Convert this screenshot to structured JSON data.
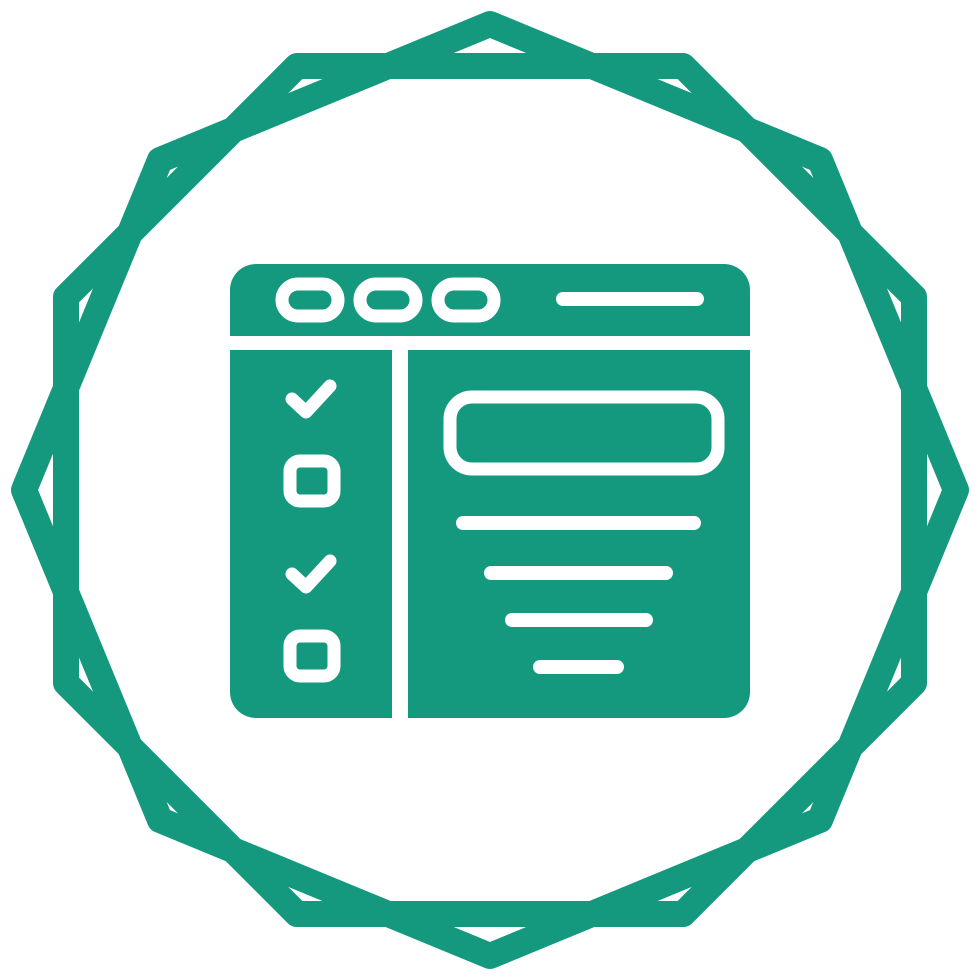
{
  "icon": {
    "name": "checklist-browser-icon",
    "badge_frame": "wavy-octagon-badge",
    "colors": {
      "primary": "#14997F",
      "background": "#FFFFFF"
    },
    "checklist": [
      {
        "state": "checked",
        "icon": "checkmark-icon"
      },
      {
        "state": "unchecked",
        "icon": "empty-checkbox-icon"
      },
      {
        "state": "checked",
        "icon": "checkmark-icon"
      },
      {
        "state": "unchecked",
        "icon": "empty-checkbox-icon"
      }
    ],
    "window_controls": 3,
    "content_lines": 4
  }
}
